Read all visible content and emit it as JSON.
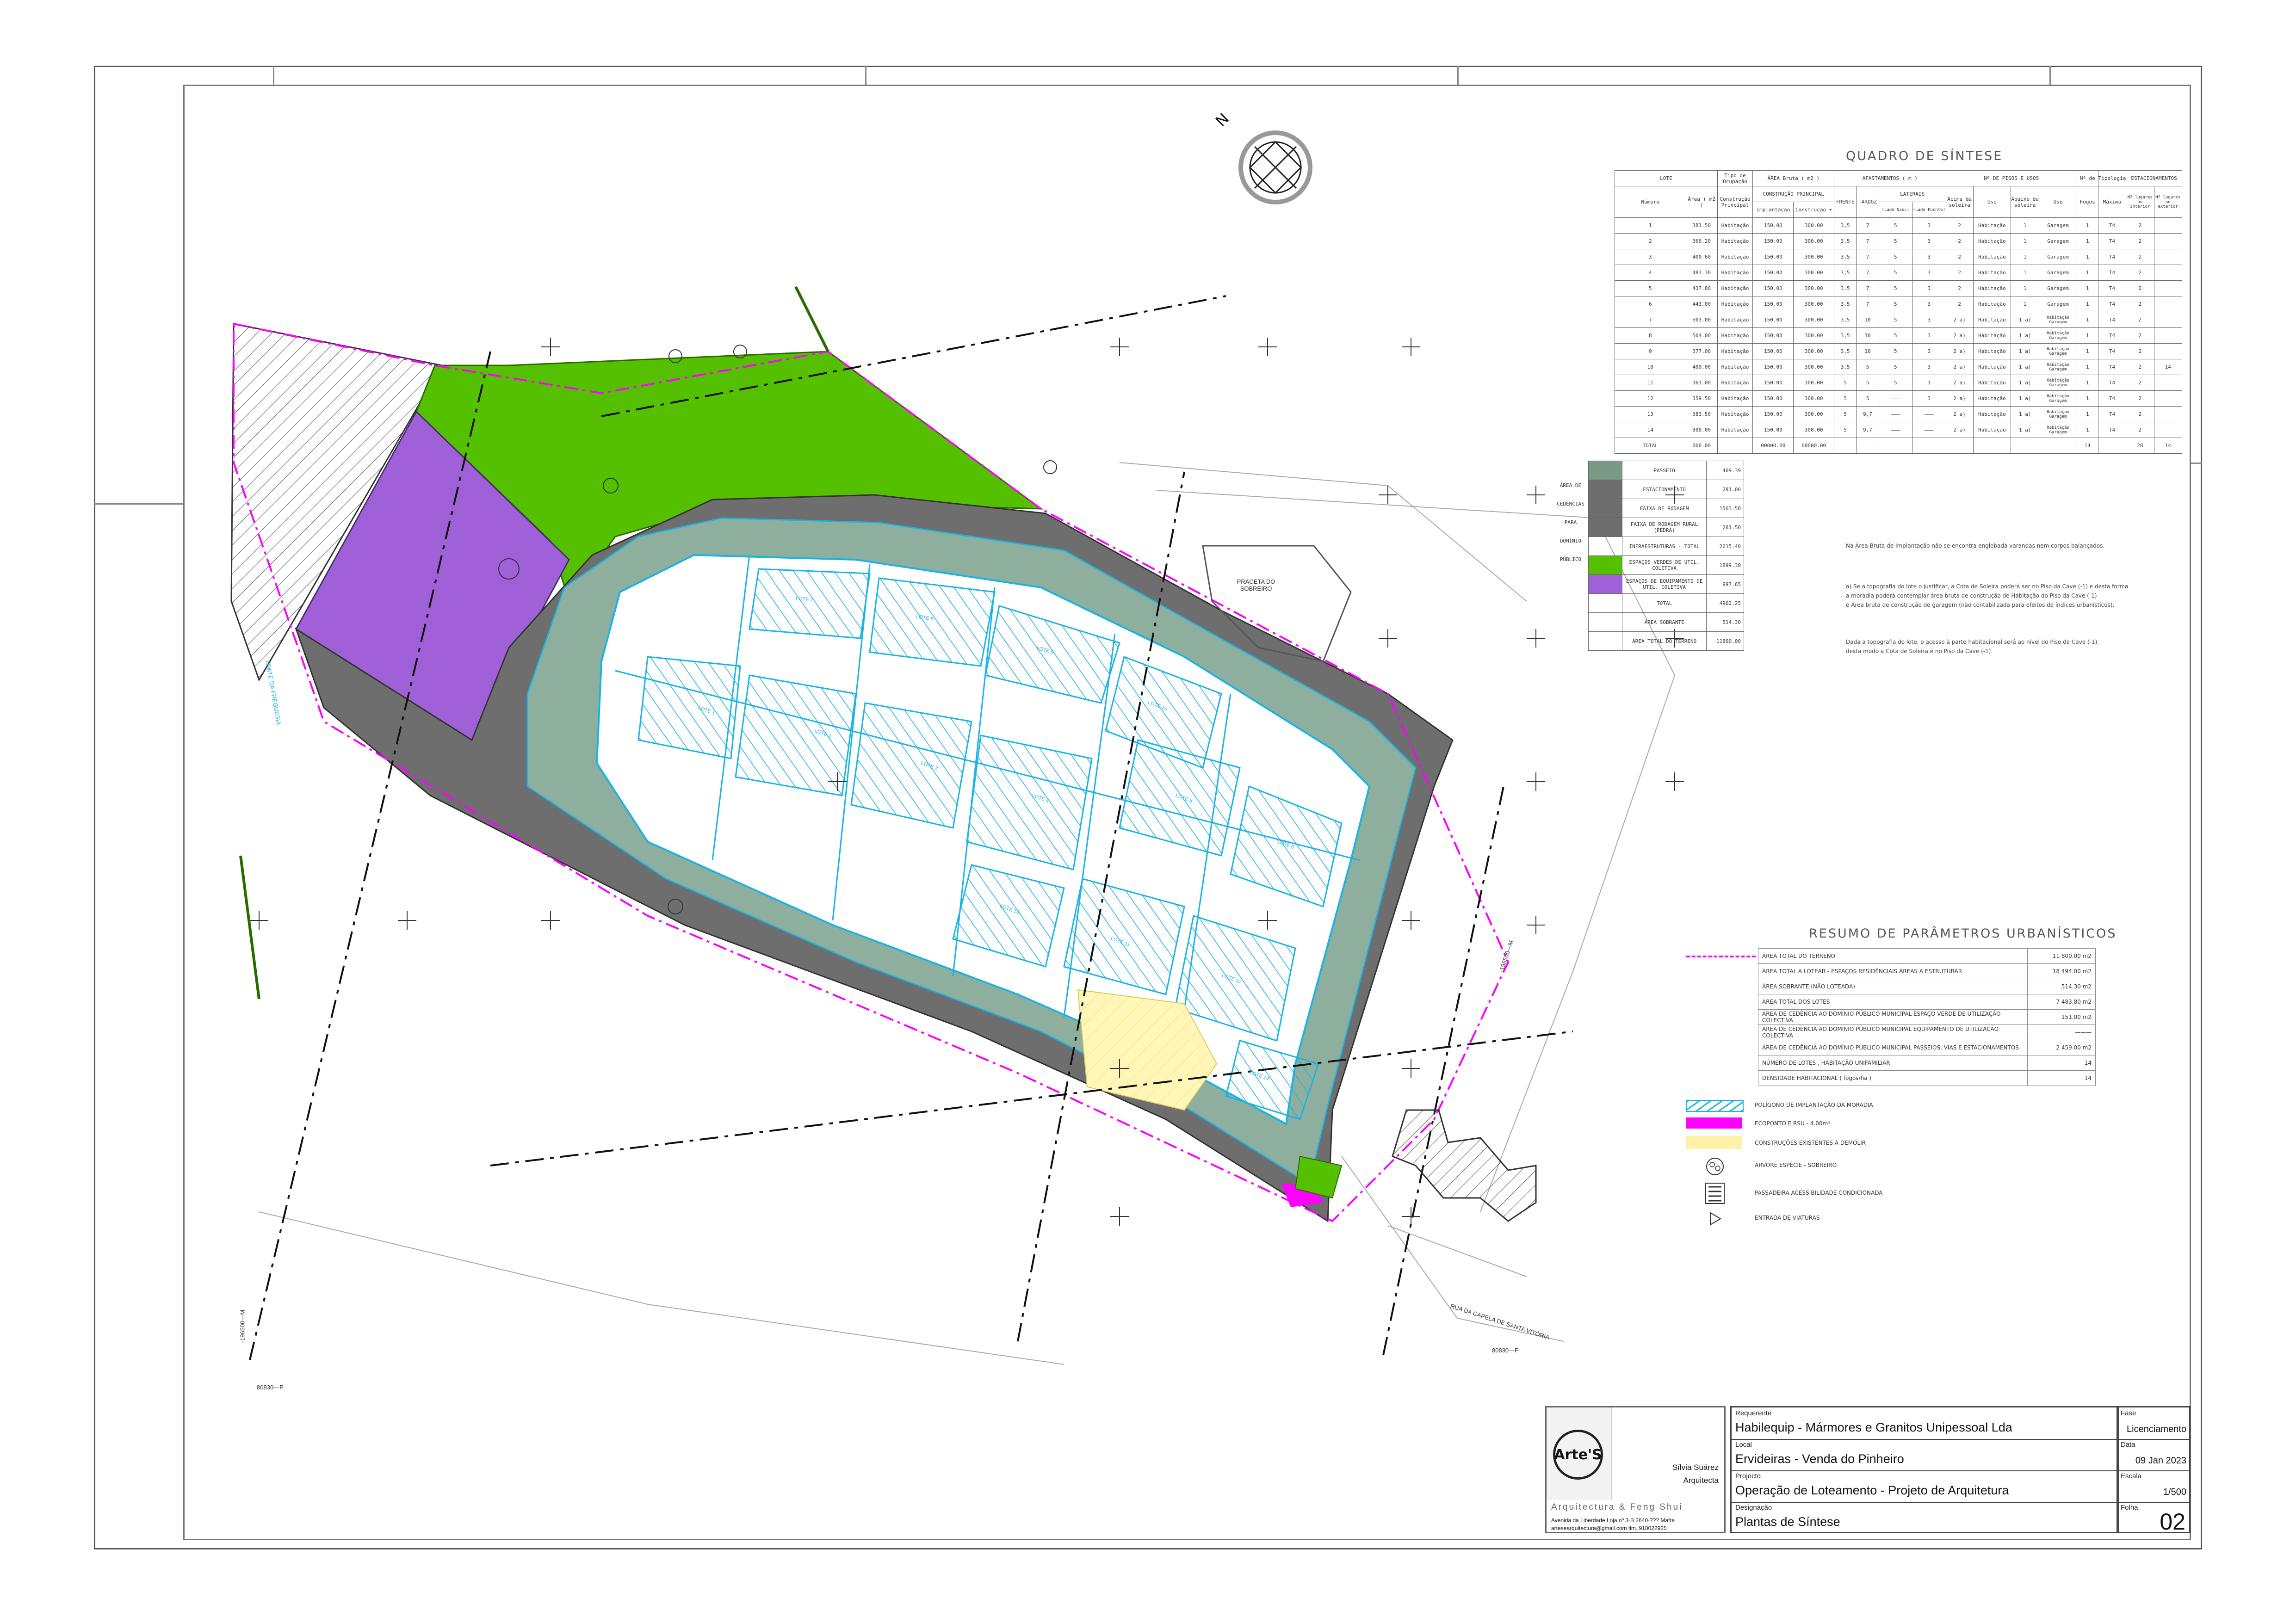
{
  "north": {
    "label": "N"
  },
  "quadro": {
    "title": "QUADRO DE SÍNTESE",
    "h1": {
      "lote": "LOTE",
      "tipo": "Tipo de Ocupação",
      "area_bruta": "ÁREA Bruta ( m2 )",
      "afast": "AFASTAMENTOS ( m )",
      "pisos": "Nº DE PISOS E USOS",
      "fogos": "Nº de",
      "tipologia": "Tipologia",
      "estac": "ESTACIONAMENTOS"
    },
    "h2": {
      "numero": "Número",
      "area": "Área ( m2 )",
      "construcao": "Construção Principal",
      "cp": "CONSTRUÇÃO PRINCIPAL",
      "frente": "FRENTE",
      "tardoz": "TARDOZ",
      "laterais": "LATERAIS",
      "acima": "Acima da soleira",
      "uso1": "Uso",
      "abaixo": "Abaixo da soleira",
      "uso2": "Uso",
      "fogos2": "Fogos",
      "maxima": "Máxima",
      "est_int": "Nº lugares no interior",
      "est_ext": "Nº lugares no exterior"
    },
    "h3": {
      "implantacao": "Implantação",
      "construcao": "Construção +",
      "lat1": "(Lado Nasc)",
      "lat2": "(Lado Poente)"
    },
    "rows": [
      {
        "n": "1",
        "area": "381.50",
        "tipo": "Habitação",
        "imp": "150.00",
        "con": "300.00",
        "fr": "3,5",
        "tz": "7",
        "l1": "5",
        "l2": "3",
        "ac": "2",
        "u1": "Habitação",
        "ab": "1",
        "u2": "Garagem",
        "fo": "1",
        "ty": "T4",
        "ei": "2",
        "ee": ""
      },
      {
        "n": "2",
        "area": "366.20",
        "tipo": "Habitação",
        "imp": "150.00",
        "con": "300.00",
        "fr": "3,5",
        "tz": "7",
        "l1": "5",
        "l2": "3",
        "ac": "2",
        "u1": "Habitação",
        "ab": "1",
        "u2": "Garagem",
        "fo": "1",
        "ty": "T4",
        "ei": "2",
        "ee": ""
      },
      {
        "n": "3",
        "area": "400.60",
        "tipo": "Habitação",
        "imp": "150.00",
        "con": "300.00",
        "fr": "3,5",
        "tz": "7",
        "l1": "5",
        "l2": "3",
        "ac": "2",
        "u1": "Habitação",
        "ab": "1",
        "u2": "Garagem",
        "fo": "1",
        "ty": "T4",
        "ei": "2",
        "ee": ""
      },
      {
        "n": "4",
        "area": "483.30",
        "tipo": "Habitação",
        "imp": "150.00",
        "con": "300.00",
        "fr": "3,5",
        "tz": "7",
        "l1": "5",
        "l2": "3",
        "ac": "2",
        "u1": "Habitação",
        "ab": "1",
        "u2": "Garagem",
        "fo": "1",
        "ty": "T4",
        "ei": "2",
        "ee": ""
      },
      {
        "n": "5",
        "area": "437.80",
        "tipo": "Habitação",
        "imp": "150.00",
        "con": "300.00",
        "fr": "3,5",
        "tz": "7",
        "l1": "5",
        "l2": "3",
        "ac": "2",
        "u1": "Habitação",
        "ab": "1",
        "u2": "Garagem",
        "fo": "1",
        "ty": "T4",
        "ei": "2",
        "ee": ""
      },
      {
        "n": "6",
        "area": "443.00",
        "tipo": "Habitação",
        "imp": "150.00",
        "con": "300.00",
        "fr": "3,5",
        "tz": "7",
        "l1": "5",
        "l2": "3",
        "ac": "2",
        "u1": "Habitação",
        "ab": "1",
        "u2": "Garagem",
        "fo": "1",
        "ty": "T4",
        "ei": "2",
        "ee": ""
      },
      {
        "n": "7",
        "area": "503.00",
        "tipo": "Habitação",
        "imp": "150.00",
        "con": "300.00",
        "fr": "3,5",
        "tz": "10",
        "l1": "5",
        "l2": "3",
        "ac": "2 a)",
        "u1": "Habitação",
        "ab": "1 a)",
        "u2": "Habitação Garagem",
        "fo": "1",
        "ty": "T4",
        "ei": "2",
        "ee": ""
      },
      {
        "n": "8",
        "area": "504.00",
        "tipo": "Habitação",
        "imp": "150.00",
        "con": "300.00",
        "fr": "3,5",
        "tz": "10",
        "l1": "5",
        "l2": "3",
        "ac": "2 a)",
        "u1": "Habitação",
        "ab": "1 a)",
        "u2": "Habitação Garagem",
        "fo": "1",
        "ty": "T4",
        "ei": "2",
        "ee": ""
      },
      {
        "n": "9",
        "area": "377.00",
        "tipo": "Habitação",
        "imp": "150.00",
        "con": "300.00",
        "fr": "3,5",
        "tz": "10",
        "l1": "5",
        "l2": "3",
        "ac": "2 a)",
        "u1": "Habitação",
        "ab": "1 a)",
        "u2": "Habitação Garagem",
        "fo": "1",
        "ty": "T4",
        "ei": "2",
        "ee": ""
      },
      {
        "n": "10",
        "area": "400.00",
        "tipo": "Habitação",
        "imp": "150.00",
        "con": "300.00",
        "fr": "3,5",
        "tz": "5",
        "l1": "5",
        "l2": "3",
        "ac": "2 a)",
        "u1": "Habitação",
        "ab": "1 a)",
        "u2": "Habitação Garagem",
        "fo": "1",
        "ty": "T4",
        "ei": "2",
        "ee": "14"
      },
      {
        "n": "11",
        "area": "361.00",
        "tipo": "Habitação",
        "imp": "150.00",
        "con": "300.00",
        "fr": "5",
        "tz": "5",
        "l1": "5",
        "l2": "3",
        "ac": "2 a)",
        "u1": "Habitação",
        "ab": "1 a)",
        "u2": "Habitação Garagem",
        "fo": "1",
        "ty": "T4",
        "ei": "2",
        "ee": ""
      },
      {
        "n": "12",
        "area": "359.50",
        "tipo": "Habitação",
        "imp": "150.00",
        "con": "300.00",
        "fr": "5",
        "tz": "5",
        "l1": "———",
        "l2": "3",
        "ac": "2 a)",
        "u1": "Habitação",
        "ab": "1 a)",
        "u2": "Habitação Garagem",
        "fo": "1",
        "ty": "T4",
        "ei": "2",
        "ee": ""
      },
      {
        "n": "13",
        "area": "383.50",
        "tipo": "Habitação",
        "imp": "150.00",
        "con": "300.00",
        "fr": "5",
        "tz": "9,7",
        "l1": "———",
        "l2": "———",
        "ac": "2 a)",
        "u1": "Habitação",
        "ab": "1 a)",
        "u2": "Habitação Garagem",
        "fo": "1",
        "ty": "T4",
        "ei": "2",
        "ee": ""
      },
      {
        "n": "14",
        "area": "300.00",
        "tipo": "Habitação",
        "imp": "150.00",
        "con": "300.00",
        "fr": "5",
        "tz": "9,7",
        "l1": "———",
        "l2": "———",
        "ac": "2 a)",
        "u1": "Habitação",
        "ab": "1 a)",
        "u2": "Habitação Garagem",
        "fo": "1",
        "ty": "T4",
        "ei": "2",
        "ee": ""
      }
    ],
    "total": {
      "label": "TOTAL",
      "area": "000.00",
      "imp": "00000.00",
      "con": "00000.00",
      "fo": "14",
      "ei": "28",
      "ee": "14"
    }
  },
  "cedencias": {
    "side_label": [
      "ÁREA DE",
      "CEDÊNCIAS",
      "PARA",
      "DOMÍNIO",
      "PÚBLICO"
    ],
    "rows": [
      {
        "label": "PASSEIO",
        "value": "469.39",
        "color": "#7a9a86"
      },
      {
        "label": "ESTACIONAMENTO",
        "value": "281.00",
        "color": "#6e6e6e"
      },
      {
        "label": "FAIXA DE RODAGEM",
        "value": "1563.50",
        "color": "#6e6e6e"
      },
      {
        "label": "FAIXA DE RODAGEM RURAL (PEDRA)",
        "value": "281.50",
        "color": "#6e6e6e"
      },
      {
        "label": "INFRAESTRUTURAS - TOTAL",
        "value": "2615.40",
        "color": ""
      },
      {
        "label": "ESPAÇOS VERDES DE UTIL. COLETIVA",
        "value": "1899.30",
        "color": "#55c000"
      },
      {
        "label": "ESPAÇOS DE EQUIPAMENTO DE UTIL. COLETIVA",
        "value": "997.65",
        "color": "#9f60d8"
      },
      {
        "label": "TOTAL",
        "value": "4902.25",
        "color": ""
      },
      {
        "label": "ÁREA SOBRANTE",
        "value": "514.30",
        "color": ""
      },
      {
        "label": "ÁREA TOTAL DO TERRENO",
        "value": "11800.00",
        "color": ""
      }
    ]
  },
  "notes": {
    "n1": "Na Área Bruta de Implantação não se encontra englobada varandas nem corpos balançados.",
    "n2": [
      "a) Se a topografia do lote o justificar, a Cota de Soleira poderá ser no Piso da Cave (-1) e desta forma",
      "a moradia poderá contemplar área bruta de construção de Habitação do Piso da Cave (-1)",
      "e Área bruta de construção de garagem (não contabilizada para efeitos de índices urbanísticos)."
    ],
    "n3": [
      "Dada a topografia do lote, o acesso à parte habitacional será ao nível do Piso da Cave (-1),",
      "desta modo a Cota de Soleira é no Piso da Cave (-1)."
    ]
  },
  "resumo": {
    "title": "RESUMO DE PARÂMETROS URBANÍSTICOS",
    "rows": [
      {
        "label": "ÁREA TOTAL DO TERRENO",
        "value": "11 800.00 m2"
      },
      {
        "label": "ÁREA TOTAL A LOTEAR - ESPAÇOS RESIDÊNCIAIS   ÁREAS A ESTRUTURAR",
        "value": "18 494.00 m2"
      },
      {
        "label": "ÁREA SOBRANTE (NÃO LOTEADA)",
        "value": "514.30 m2"
      },
      {
        "label": "ÁREA TOTAL DOS LOTES",
        "value": "7 483.80 m2"
      },
      {
        "label": "ÁREA DE CEDÊNCIA AO DOMÍNIO PÚBLICO MUNICIPAL   ESPAÇO VERDE DE UTILIZAÇÃO COLECTIVA",
        "value": "151.00 m2"
      },
      {
        "label": "ÁREA DE CEDÊNCIA AO DOMÍNIO PÚBLICO MUNICIPAL   EQUIPAMENTO DE UTILIZAÇÃO COLECTIVA",
        "value": "———"
      },
      {
        "label": "ÁREA DE CEDÊNCIA AO DOMÍNIO PÚBLICO MUNICIPAL   PASSEIOS, VIAS E ESTACIONAMENTOS",
        "value": "2 459.00 m2"
      },
      {
        "label": "NÚMERO DE LOTES , HABITAÇÃO UNIFAMILIAR",
        "value": "14"
      },
      {
        "label": "DENSIDADE HABITACIONAL ( fogos/ha )",
        "value": "14"
      }
    ]
  },
  "legend": [
    {
      "key": "poligono",
      "label": "POLÍGONO DE IMPLANTAÇÃO DA MORADIA"
    },
    {
      "key": "ecoponto",
      "label": "ECOPONTO E RSU - 4.00m²"
    },
    {
      "key": "demolir",
      "label": "CONSTRUÇÕES EXISTENTES A DEMOLIR"
    },
    {
      "key": "arvore",
      "label": "ÁRVORE ESPÉCIE - SOBREIRO"
    },
    {
      "key": "passadeira",
      "label": "PASSADEIRA ACESSIBILIDADE CONDICIONADA"
    },
    {
      "key": "entrada",
      "label": "ENTRADA DE VIATURAS"
    }
  ],
  "map_labels": {
    "praceta": "PRACETA DO SOBREIRO",
    "rua": "RUA DA CAPELA DE SANTA VITÓRIA",
    "limite": "LIMITE DA FREGUESIA",
    "coord1": "80830—P",
    "coord2": "80830—P",
    "coord3": "-196500—M",
    "coord4": "-196500—M",
    "lotes": [
      "LOTE 1",
      "LOTE 2",
      "LOTE 3",
      "LOTE 4",
      "LOTE 5",
      "LOTE 6",
      "LOTE 7",
      "LOTE 8",
      "LOTE 9",
      "LOTE 10",
      "LOTE 11",
      "LOTE 12",
      "LOTE 13",
      "LOTE 14"
    ]
  },
  "titleblock": {
    "logo": "Arte'S",
    "architect_name": "Sílvia Suárez",
    "architect_role": "Arquitecta",
    "tagline": "Arquitectura   &   Feng Shui",
    "address": "Avenida da Liberdade  Loja nº 3-B  2640-??? Mafra",
    "contact": "artesearquitectura@gmail.com   tlm. 918022925",
    "requerente_label": "Requerente",
    "requerente": "Habilequip - Mármores e  Granitos Unipessoal Lda",
    "local_label": "Local",
    "local": "Ervideiras - Venda do Pinheiro",
    "projecto_label": "Projecto",
    "projecto": "Operação de Loteamento  -  Projeto de Arquitetura",
    "designacao_label": "Designação",
    "designacao": "Plantas de Síntese",
    "fase_label": "Fase",
    "fase": "Licenciamento",
    "data_label": "Data",
    "data": "09 Jan 2023",
    "escala_label": "Escala",
    "escala": "1/500",
    "folha_label": "Folha",
    "folha": "02"
  },
  "colors": {
    "green": "#55c000",
    "purple": "#9f60d8",
    "road": "#6e6e6e",
    "sidewalk": "#8faf9e",
    "lot_hatch": "#18b4e6",
    "magenta": "#ff00ff",
    "yellow": "#fff2a8"
  }
}
